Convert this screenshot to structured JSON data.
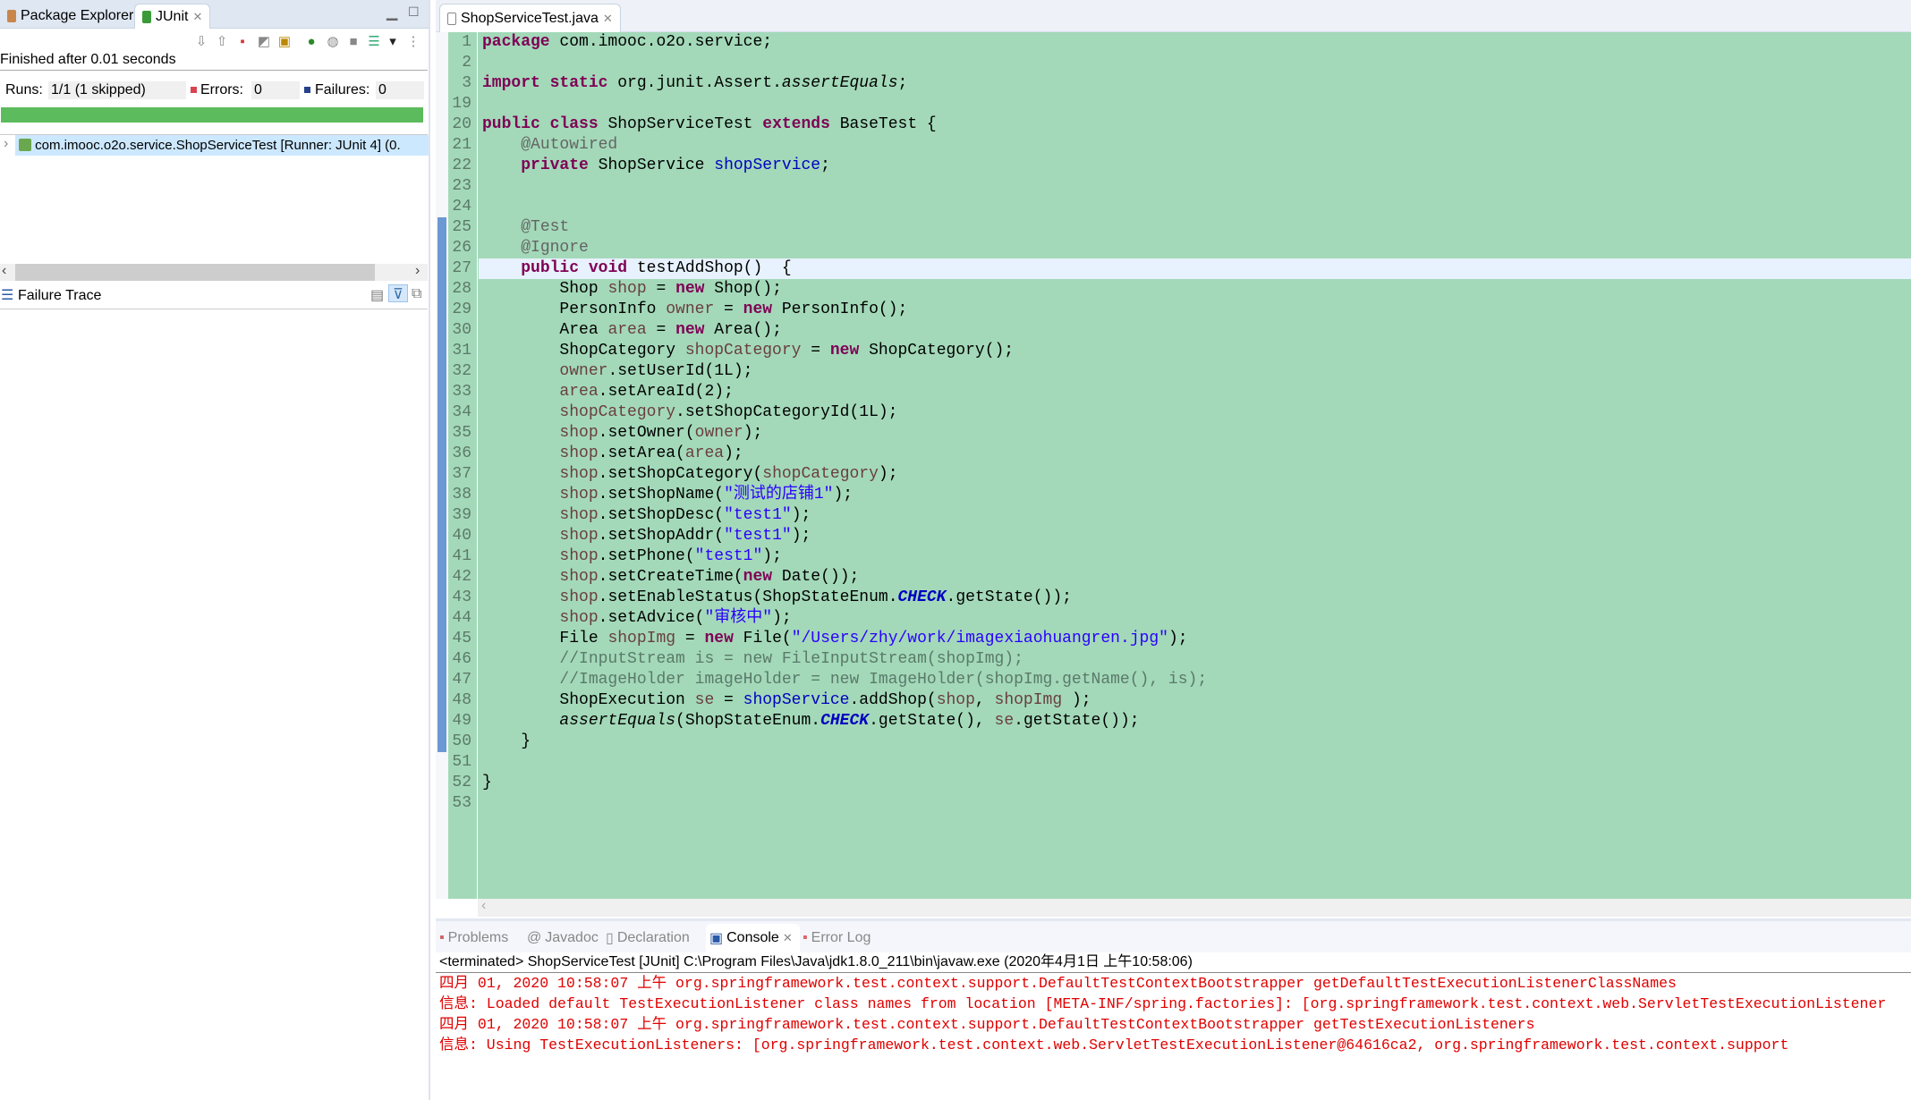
{
  "left_panel": {
    "tabs": [
      {
        "label": "Package Explorer",
        "icon": "package-icon"
      },
      {
        "label": "JUnit",
        "icon": "junit-icon"
      }
    ],
    "status": "Finished after 0.01 seconds",
    "runs_label": "Runs:",
    "runs_value": "1/1 (1 skipped)",
    "errors_label": "Errors:",
    "errors_value": "0",
    "failures_label": "Failures:",
    "failures_value": "0",
    "progress": 100,
    "progress_color": "#5cbb5c",
    "tree_item": "com.imooc.o2o.service.ShopServiceTest [Runner: JUnit 4] (0.",
    "failure_trace_label": "Failure Trace"
  },
  "editor": {
    "tab_label": "ShopServiceTest.java",
    "background": "#a3d9b9",
    "current_line": "27",
    "lines": [
      {
        "n": "1",
        "t": [
          [
            "kw",
            "package"
          ],
          [
            "plain",
            " com.imooc.o2o.service;"
          ]
        ]
      },
      {
        "n": "2",
        "t": []
      },
      {
        "n": "3",
        "t": [
          [
            "kw",
            "import"
          ],
          [
            "plain",
            " "
          ],
          [
            "kw",
            "static"
          ],
          [
            "plain",
            " org.junit.Assert."
          ],
          [
            "smi",
            "assertEquals"
          ],
          [
            "plain",
            ";"
          ]
        ]
      },
      {
        "n": "19",
        "t": []
      },
      {
        "n": "20",
        "t": [
          [
            "kw",
            "public"
          ],
          [
            "plain",
            " "
          ],
          [
            "kw",
            "class"
          ],
          [
            "plain",
            " ShopServiceTest "
          ],
          [
            "kw",
            "extends"
          ],
          [
            "plain",
            " BaseTest {"
          ]
        ]
      },
      {
        "n": "21",
        "t": [
          [
            "plain",
            "    "
          ],
          [
            "ann",
            "@Autowired"
          ]
        ]
      },
      {
        "n": "22",
        "t": [
          [
            "plain",
            "    "
          ],
          [
            "kw",
            "private"
          ],
          [
            "plain",
            " ShopService "
          ],
          [
            "fld",
            "shopService"
          ],
          [
            "plain",
            ";"
          ]
        ]
      },
      {
        "n": "23",
        "t": []
      },
      {
        "n": "24",
        "t": []
      },
      {
        "n": "25",
        "t": [
          [
            "plain",
            "    "
          ],
          [
            "ann",
            "@Test"
          ]
        ]
      },
      {
        "n": "26",
        "t": [
          [
            "plain",
            "    "
          ],
          [
            "ann",
            "@Ignore"
          ]
        ]
      },
      {
        "n": "27",
        "t": [
          [
            "plain",
            "    "
          ],
          [
            "kw",
            "public"
          ],
          [
            "plain",
            " "
          ],
          [
            "kw",
            "void"
          ],
          [
            "plain",
            " testAddShop()  {"
          ]
        ]
      },
      {
        "n": "28",
        "t": [
          [
            "plain",
            "        Shop "
          ],
          [
            "loc",
            "shop"
          ],
          [
            "plain",
            " = "
          ],
          [
            "kw",
            "new"
          ],
          [
            "plain",
            " Shop();"
          ]
        ]
      },
      {
        "n": "29",
        "t": [
          [
            "plain",
            "        PersonInfo "
          ],
          [
            "loc",
            "owner"
          ],
          [
            "plain",
            " = "
          ],
          [
            "kw",
            "new"
          ],
          [
            "plain",
            " PersonInfo();"
          ]
        ]
      },
      {
        "n": "30",
        "t": [
          [
            "plain",
            "        Area "
          ],
          [
            "loc",
            "area"
          ],
          [
            "plain",
            " = "
          ],
          [
            "kw",
            "new"
          ],
          [
            "plain",
            " Area();"
          ]
        ]
      },
      {
        "n": "31",
        "t": [
          [
            "plain",
            "        ShopCategory "
          ],
          [
            "loc",
            "shopCategory"
          ],
          [
            "plain",
            " = "
          ],
          [
            "kw",
            "new"
          ],
          [
            "plain",
            " ShopCategory();"
          ]
        ]
      },
      {
        "n": "32",
        "t": [
          [
            "plain",
            "        "
          ],
          [
            "loc",
            "owner"
          ],
          [
            "plain",
            ".setUserId(1L);"
          ]
        ]
      },
      {
        "n": "33",
        "t": [
          [
            "plain",
            "        "
          ],
          [
            "loc",
            "area"
          ],
          [
            "plain",
            ".setAreaId(2);"
          ]
        ]
      },
      {
        "n": "34",
        "t": [
          [
            "plain",
            "        "
          ],
          [
            "loc",
            "shopCategory"
          ],
          [
            "plain",
            ".setShopCategoryId(1L);"
          ]
        ]
      },
      {
        "n": "35",
        "t": [
          [
            "plain",
            "        "
          ],
          [
            "loc",
            "shop"
          ],
          [
            "plain",
            ".setOwner("
          ],
          [
            "loc",
            "owner"
          ],
          [
            "plain",
            ");"
          ]
        ]
      },
      {
        "n": "36",
        "t": [
          [
            "plain",
            "        "
          ],
          [
            "loc",
            "shop"
          ],
          [
            "plain",
            ".setArea("
          ],
          [
            "loc",
            "area"
          ],
          [
            "plain",
            ");"
          ]
        ]
      },
      {
        "n": "37",
        "t": [
          [
            "plain",
            "        "
          ],
          [
            "loc",
            "shop"
          ],
          [
            "plain",
            ".setShopCategory("
          ],
          [
            "loc",
            "shopCategory"
          ],
          [
            "plain",
            ");"
          ]
        ]
      },
      {
        "n": "38",
        "t": [
          [
            "plain",
            "        "
          ],
          [
            "loc",
            "shop"
          ],
          [
            "plain",
            ".setShopName("
          ],
          [
            "str",
            "\"测试的店铺1\""
          ],
          [
            "plain",
            ");"
          ]
        ]
      },
      {
        "n": "39",
        "t": [
          [
            "plain",
            "        "
          ],
          [
            "loc",
            "shop"
          ],
          [
            "plain",
            ".setShopDesc("
          ],
          [
            "str",
            "\"test1\""
          ],
          [
            "plain",
            ");"
          ]
        ]
      },
      {
        "n": "40",
        "t": [
          [
            "plain",
            "        "
          ],
          [
            "loc",
            "shop"
          ],
          [
            "plain",
            ".setShopAddr("
          ],
          [
            "str",
            "\"test1\""
          ],
          [
            "plain",
            ");"
          ]
        ]
      },
      {
        "n": "41",
        "t": [
          [
            "plain",
            "        "
          ],
          [
            "loc",
            "shop"
          ],
          [
            "plain",
            ".setPhone("
          ],
          [
            "str",
            "\"test1\""
          ],
          [
            "plain",
            ");"
          ]
        ]
      },
      {
        "n": "42",
        "t": [
          [
            "plain",
            "        "
          ],
          [
            "loc",
            "shop"
          ],
          [
            "plain",
            ".setCreateTime("
          ],
          [
            "kw",
            "new"
          ],
          [
            "plain",
            " Date());"
          ]
        ]
      },
      {
        "n": "43",
        "t": [
          [
            "plain",
            "        "
          ],
          [
            "loc",
            "shop"
          ],
          [
            "plain",
            ".setEnableStatus(ShopStateEnum."
          ],
          [
            "sfi",
            "CHECK"
          ],
          [
            "plain",
            ".getState());"
          ]
        ]
      },
      {
        "n": "44",
        "t": [
          [
            "plain",
            "        "
          ],
          [
            "loc",
            "shop"
          ],
          [
            "plain",
            ".setAdvice("
          ],
          [
            "str",
            "\"审核中\""
          ],
          [
            "plain",
            ");"
          ]
        ]
      },
      {
        "n": "45",
        "t": [
          [
            "plain",
            "        File "
          ],
          [
            "loc",
            "shopImg"
          ],
          [
            "plain",
            " = "
          ],
          [
            "kw",
            "new"
          ],
          [
            "plain",
            " File("
          ],
          [
            "str",
            "\"/Users/zhy/work/imagexiaohuangren.jpg\""
          ],
          [
            "plain",
            ");"
          ]
        ]
      },
      {
        "n": "46",
        "t": [
          [
            "plain",
            "        "
          ],
          [
            "cmt",
            "//InputStream is = new FileInputStream(shopImg);"
          ]
        ]
      },
      {
        "n": "47",
        "t": [
          [
            "plain",
            "        "
          ],
          [
            "cmt",
            "//ImageHolder imageHolder = new ImageHolder(shopImg.getName(), is);"
          ]
        ]
      },
      {
        "n": "48",
        "t": [
          [
            "plain",
            "        ShopExecution "
          ],
          [
            "loc",
            "se"
          ],
          [
            "plain",
            " = "
          ],
          [
            "fld",
            "shopService"
          ],
          [
            "plain",
            ".addShop("
          ],
          [
            "loc",
            "shop"
          ],
          [
            "plain",
            ", "
          ],
          [
            "loc",
            "shopImg"
          ],
          [
            "plain",
            " );"
          ]
        ]
      },
      {
        "n": "49",
        "t": [
          [
            "plain",
            "        "
          ],
          [
            "smi",
            "assertEquals"
          ],
          [
            "plain",
            "(ShopStateEnum."
          ],
          [
            "sfi",
            "CHECK"
          ],
          [
            "plain",
            ".getState(), "
          ],
          [
            "loc",
            "se"
          ],
          [
            "plain",
            ".getState());"
          ]
        ]
      },
      {
        "n": "50",
        "t": [
          [
            "plain",
            "    }"
          ]
        ]
      },
      {
        "n": "51",
        "t": []
      },
      {
        "n": "52",
        "t": [
          [
            "plain",
            "}"
          ]
        ]
      },
      {
        "n": "53",
        "t": []
      }
    ]
  },
  "bottom_panel": {
    "tabs": [
      {
        "label": "Problems",
        "icon": "problems-icon"
      },
      {
        "label": "Javadoc",
        "icon": "javadoc-icon"
      },
      {
        "label": "Declaration",
        "icon": "declaration-icon"
      },
      {
        "label": "Console",
        "icon": "console-icon",
        "active": true
      },
      {
        "label": "Error Log",
        "icon": "error-log-icon"
      }
    ],
    "terminated": "<terminated> ShopServiceTest [JUnit] C:\\Program Files\\Java\\jdk1.8.0_211\\bin\\javaw.exe (2020年4月1日 上午10:58:06)",
    "console_lines": [
      "四月 01, 2020 10:58:07 上午 org.springframework.test.context.support.DefaultTestContextBootstrapper getDefaultTestExecutionListenerClassNames",
      "信息: Loaded default TestExecutionListener class names from location [META-INF/spring.factories]: [org.springframework.test.context.web.ServletTestExecutionListener",
      "四月 01, 2020 10:58:07 上午 org.springframework.test.context.support.DefaultTestContextBootstrapper getTestExecutionListeners",
      "信息: Using TestExecutionListeners: [org.springframework.test.context.web.ServletTestExecutionListener@64616ca2, org.springframework.test.context.support"
    ],
    "console_color": "#e00000"
  }
}
